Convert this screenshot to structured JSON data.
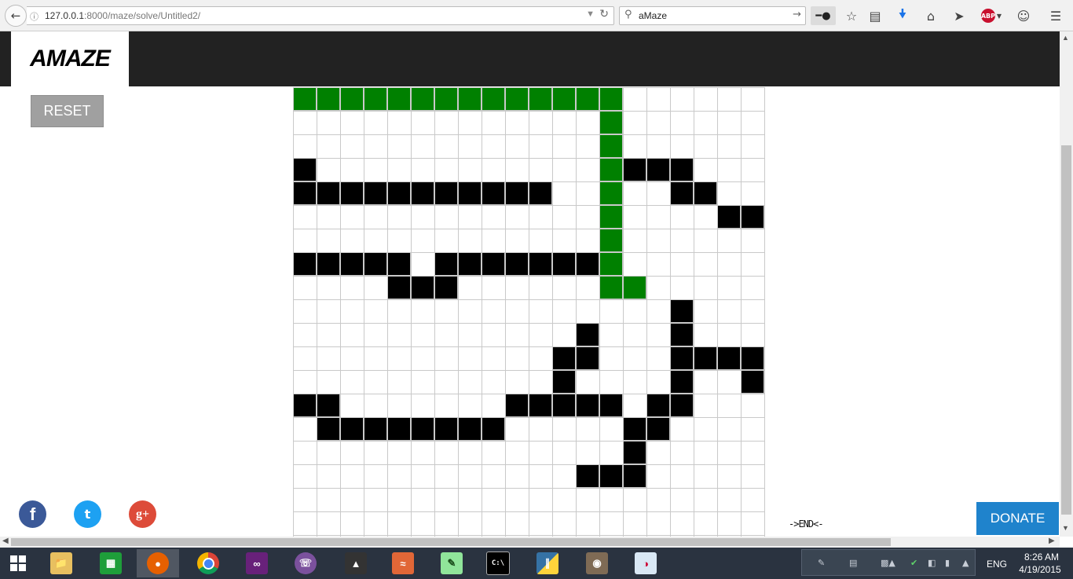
{
  "browser": {
    "url_host": "127.0.0.1",
    "url_path": ":8000/maze/solve/Untitled2/",
    "search_value": "aMaze",
    "abp_label": "ABP"
  },
  "site": {
    "logo": "AMAZE",
    "reset_label": "RESET",
    "end_label": "->END<-",
    "donate_label": "DONATE",
    "social": {
      "facebook": "f",
      "twitter": "t",
      "googleplus": "g+"
    }
  },
  "maze": {
    "rows": 19,
    "cols": 20,
    "colors": {
      "wall": "#000000",
      "path": "#008000",
      "empty": "#ffffff",
      "grid": "#c9c9c9"
    },
    "grid": [
      "PPPPPPPPPPPPPP......",
      ".............P......",
      ".............P......",
      "W............PWWW...",
      "WWWWWWWWWWW..P..WW..",
      ".............P....WW",
      ".............P......",
      "WWWWW.WWWWWWWP......",
      "....WWW......PP.....",
      "................W...",
      "............W...W...",
      "...........WW...WWWW",
      "...........W....W..W",
      "WW.......WWWWW.WW...",
      ".WWWWWWWW.....WW....",
      "..............W.....",
      "............WWW.....",
      "....................",
      "...................."
    ]
  },
  "taskbar": {
    "apps": [
      "windows-store",
      "firefox",
      "chrome",
      "visual-studio",
      "viber",
      "unity",
      "matlab",
      "notepad-plus-plus",
      "command-prompt",
      "python",
      "gimp",
      "paint"
    ],
    "lang": "ENG",
    "time": "8:26 AM",
    "date": "4/19/2015"
  }
}
